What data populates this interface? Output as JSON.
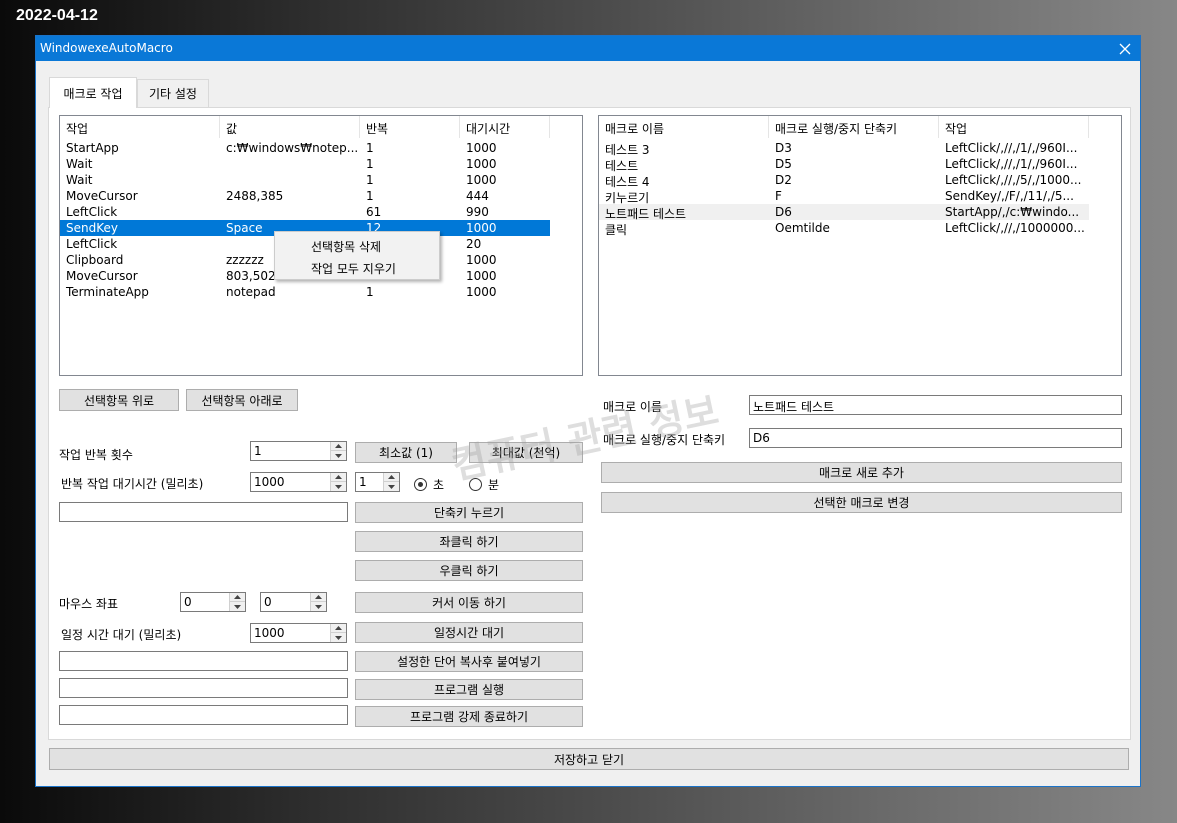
{
  "desktop": {
    "date": "2022-04-12"
  },
  "window": {
    "title": "WindowexeAutoMacro",
    "close_glyph": "✕"
  },
  "tabs": [
    {
      "label": "매크로 작업",
      "active": true
    },
    {
      "label": "기타 설정",
      "active": false
    }
  ],
  "task_list": {
    "columns": [
      "작업",
      "값",
      "반복",
      "대기시간"
    ],
    "rows": [
      [
        "StartApp",
        "c:₩windows₩notep...",
        "1",
        "1000"
      ],
      [
        "Wait",
        "",
        "1",
        "1000"
      ],
      [
        "Wait",
        "",
        "1",
        "1000"
      ],
      [
        "MoveCursor",
        "2488,385",
        "1",
        "444"
      ],
      [
        "LeftClick",
        "",
        "61",
        "990"
      ],
      [
        "SendKey",
        "Space",
        "12",
        "1000"
      ],
      [
        "LeftClick",
        "",
        "",
        "20"
      ],
      [
        "Clipboard",
        "zzzzzz",
        "",
        "1000"
      ],
      [
        "MoveCursor",
        "803,502",
        "",
        "1000"
      ],
      [
        "TerminateApp",
        "notepad",
        "1",
        "1000"
      ]
    ],
    "selected_index": 5
  },
  "context_menu": {
    "items": [
      "선택항목 삭제",
      "작업 모두 지우기"
    ]
  },
  "macro_list": {
    "columns": [
      "매크로 이름",
      "매크로 실행/중지 단축키",
      "작업"
    ],
    "rows": [
      [
        " 테스트 3",
        "D3",
        "LeftClick/,//,/1/,/960I..."
      ],
      [
        " 테스트",
        "D5",
        "LeftClick/,//,/1/,/960I..."
      ],
      [
        " 테스트 4",
        "D2",
        "LeftClick/,//,/5/,/1000..."
      ],
      [
        "키누르기",
        "F",
        "SendKey/,/F/,/11/,/5..."
      ],
      [
        "노트패드 테스트",
        "D6",
        "StartApp/,/c:₩windo..."
      ],
      [
        "클릭",
        "Oemtilde",
        "LeftClick/,//,/1000000..."
      ]
    ],
    "hot_index": 4
  },
  "buttons": {
    "move_up": "선택항목 위로",
    "move_down": "선택항목 아래로",
    "min_value": "최소값 (1)",
    "max_value": "최대값 (천억)",
    "press_hotkey": "단축키 누르기",
    "left_click": "좌클릭 하기",
    "right_click": "우클릭 하기",
    "move_cursor": "커서 이동 하기",
    "wait": "일정시간 대기",
    "paste_word": "설정한 단어 복사후 붙여넣기",
    "run_program": "프로그램 실행",
    "kill_program": "프로그램 강제 종료하기",
    "add_macro": "매크로 새로 추가",
    "change_macro": "선택한 매크로 변경",
    "save_close": "저장하고 닫기"
  },
  "form": {
    "repeat_label": "작업 반복 횟수",
    "repeat_value": "1",
    "repeat_wait_label": "반복 작업 대기시간 (밀리초)",
    "repeat_wait_value": "1000",
    "unit_value": "1",
    "radio_seconds": "초",
    "radio_minutes": "분",
    "hotkey_text": "",
    "mouse_label": "마우스 좌표",
    "mouse_x": "0",
    "mouse_y": "0",
    "wait_label": "일정 시간 대기 (밀리초)",
    "wait_value": "1000",
    "paste_text": "",
    "run_text": "",
    "kill_text": "",
    "macro_name_label": "매크로 이름",
    "macro_name_value": "노트패드 테스트",
    "macro_hotkey_label": "매크로 실행/중지 단축키",
    "macro_hotkey_value": "D6"
  },
  "watermark": "컴퓨터 관련 정보"
}
